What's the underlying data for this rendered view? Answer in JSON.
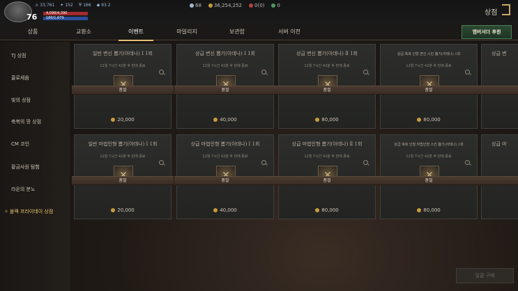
{
  "player": {
    "level": "76",
    "stat_a": "33,761",
    "stat_b": "152",
    "stat_c": "166",
    "stat_d": "93.2",
    "hp_text": "4,098/4,390",
    "mp_text": "180/1,679"
  },
  "currencies": [
    {
      "value": "68",
      "icon": "diamond-icon",
      "color": "#9fb7d6"
    },
    {
      "value": "36,254,252",
      "icon": "gold-coin-icon",
      "color": "#c99b3a"
    },
    {
      "value": "0(0)",
      "icon": "red-gem-icon",
      "color": "#b44040"
    },
    {
      "value": "0",
      "icon": "green-gem-icon",
      "color": "#4f9a5a"
    }
  ],
  "header": {
    "shop_title": "상점",
    "shop_icon": "shop-icon"
  },
  "tabs": [
    {
      "label": "상품"
    },
    {
      "label": "교환소"
    },
    {
      "label": "이벤트",
      "active": true
    },
    {
      "label": "마일리지"
    },
    {
      "label": "보관함"
    },
    {
      "label": "서버 이전"
    }
  ],
  "sponsor_button": "앰버서더 후원",
  "sidebar": [
    {
      "label": "TJ 상점"
    },
    {
      "label": "콜로세움"
    },
    {
      "label": "빛의 상점"
    },
    {
      "label": "축복의 땅 상점"
    },
    {
      "label": "CM 코인"
    },
    {
      "label": "황금사원 탐험"
    },
    {
      "label": "라온의 분노"
    },
    {
      "label": "블랙 프라이데이 상점",
      "active": true
    }
  ],
  "cards": [
    {
      "title": "일반 변신 뽑기(아데나) Ⅰ 1회",
      "sub": "12월 7시간 42분 후 판매 종료",
      "sub2": "",
      "banner": "품절",
      "price": "20,000"
    },
    {
      "title": "상급 변신 뽑기(아데나) Ⅰ 1회",
      "sub": "12월 7시간 42분 후 판매 종료",
      "sub2": "",
      "banner": "품절",
      "price": "40,000"
    },
    {
      "title": "상급 변신 뽑기(아데나) Ⅱ 1회",
      "sub": "12월 7시간 42분 후 판매 종료",
      "sub2": "",
      "banner": "품절",
      "price": "80,000"
    },
    {
      "title": "상급 축복 인형 변신 스킨 뽑기(아데나) 1회",
      "sub": "12월 7시간 42분 후 판매 종료",
      "sub2": "",
      "banner": "품절",
      "price": "80,000",
      "small": true
    },
    {
      "title": "상급 변",
      "sub": "",
      "sub2": "",
      "banner": "",
      "price": ""
    },
    {
      "title": "일반 마법인형 뽑기(아데나) Ⅰ 1회",
      "sub": "12월 7시간 42분 후 판매 종료",
      "sub2": "",
      "banner": "품절",
      "price": "20,000"
    },
    {
      "title": "상급 마법인형 뽑기(아데나) Ⅰ 1회",
      "sub": "12월 7시간 42분 후 판매 종료",
      "sub2": "",
      "banner": "품절",
      "price": "40,000"
    },
    {
      "title": "상급 마법인형 뽑기(아데나) Ⅱ 1회",
      "sub": "12월 7시간 42분 후 판매 종료",
      "sub2": "",
      "banner": "품절",
      "price": "80,000"
    },
    {
      "title": "상급 축복 인형 마법인형 스킨 뽑기(아데나) 1회",
      "sub": "12월 7시간 42분 후 판매 종료",
      "sub2": "",
      "banner": "품절",
      "price": "80,000",
      "small": true
    },
    {
      "title": "상급 마",
      "sub": "",
      "sub2": "",
      "banner": "",
      "price": ""
    }
  ],
  "buy_button": "일괄 구매"
}
